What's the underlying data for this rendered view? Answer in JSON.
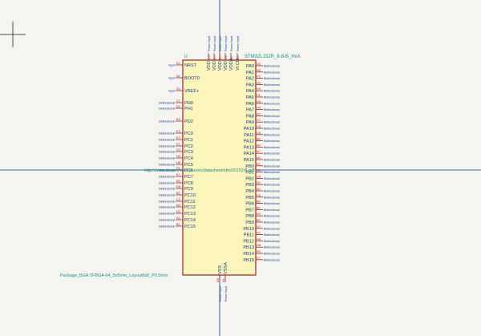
{
  "symbol": {
    "reference": "U",
    "value": "STM32L152R_6-8-B_HxA",
    "footprint": "Package_BGA:TFBGA-64_5x5mm_Layout8x8_P0.5mm",
    "datasheet": "http://www.st.com/resource/en/datasheet/stm32l152r6.pdf",
    "colors": {
      "pin": "#a02020",
      "body_fill": "#fcf6bd",
      "text": "#0e3a8c",
      "field": "#1a8a8a"
    }
  },
  "pins": {
    "top": [
      {
        "name": "VDD",
        "number": "D4",
        "type": "Power Input"
      },
      {
        "name": "VDD",
        "number": "E5",
        "type": "Power Input"
      },
      {
        "name": "VDD",
        "number": "F5",
        "type": "Power Input"
      },
      {
        "name": "VDD",
        "number": "G5",
        "type": "Power Input"
      },
      {
        "name": "VDDA",
        "number": "H7",
        "type": "Power Input"
      },
      {
        "name": "VLCD",
        "number": "B5",
        "type": "Power Input"
      }
    ],
    "left": [
      {
        "name": "NRST",
        "number": "E1",
        "type": "Input"
      },
      {
        "name": "BOOT0",
        "number": "A4",
        "type": "Input"
      },
      {
        "name": "VREF+",
        "number": "G1",
        "type": "Input"
      },
      {
        "name": "PH0",
        "number": "C1",
        "type": "Bidirectional"
      },
      {
        "name": "PH1",
        "number": "D1",
        "type": "Bidirectional"
      },
      {
        "name": "PD2",
        "number": "B3",
        "type": "Bidirectional"
      },
      {
        "name": "PC0",
        "number": "E3",
        "type": "Bidirectional"
      },
      {
        "name": "PC1",
        "number": "E2",
        "type": "Bidirectional"
      },
      {
        "name": "PC2",
        "number": "F2",
        "type": "Bidirectional"
      },
      {
        "name": "PC3",
        "number": "G1",
        "type": "Bidirectional"
      },
      {
        "name": "PC4",
        "number": "H4",
        "type": "Bidirectional"
      },
      {
        "name": "PC5",
        "number": "H5",
        "type": "Bidirectional"
      },
      {
        "name": "PC6",
        "number": "F6",
        "type": "Bidirectional"
      },
      {
        "name": "PC7",
        "number": "E7",
        "type": "Bidirectional"
      },
      {
        "name": "PC8",
        "number": "E8",
        "type": "Bidirectional"
      },
      {
        "name": "PC9",
        "number": "D8",
        "type": "Bidirectional"
      },
      {
        "name": "PC10",
        "number": "B2",
        "type": "Bidirectional"
      },
      {
        "name": "PC11",
        "number": "C2",
        "type": "Bidirectional"
      },
      {
        "name": "PC12",
        "number": "A3",
        "type": "Bidirectional"
      },
      {
        "name": "PC13",
        "number": "D2",
        "type": "Bidirectional"
      },
      {
        "name": "PC14",
        "number": "A1",
        "type": "Bidirectional"
      },
      {
        "name": "PC15",
        "number": "B1",
        "type": "Bidirectional"
      }
    ],
    "right": [
      {
        "name": "PA0",
        "number": "G3",
        "type": "Bidirectional"
      },
      {
        "name": "PA1",
        "number": "H2",
        "type": "Bidirectional"
      },
      {
        "name": "PA2",
        "number": "F3",
        "type": "Bidirectional"
      },
      {
        "name": "PA3",
        "number": "G3",
        "type": "Bidirectional"
      },
      {
        "name": "PA4",
        "number": "H3",
        "type": "Bidirectional"
      },
      {
        "name": "PA5",
        "number": "F4",
        "type": "Bidirectional"
      },
      {
        "name": "PA6",
        "number": "G4",
        "type": "Bidirectional"
      },
      {
        "name": "PA7",
        "number": "H4",
        "type": "Bidirectional"
      },
      {
        "name": "PA8",
        "number": "D7",
        "type": "Bidirectional"
      },
      {
        "name": "PA9",
        "number": "C7",
        "type": "Bidirectional"
      },
      {
        "name": "PA10",
        "number": "C6",
        "type": "Bidirectional"
      },
      {
        "name": "PA11",
        "number": "C8",
        "type": "Bidirectional"
      },
      {
        "name": "PA12",
        "number": "B8",
        "type": "Bidirectional"
      },
      {
        "name": "PA13",
        "number": "A8",
        "type": "Bidirectional"
      },
      {
        "name": "PA14",
        "number": "A7",
        "type": "Bidirectional"
      },
      {
        "name": "PA15",
        "number": "A6",
        "type": "Bidirectional"
      },
      {
        "name": "PB0",
        "number": "F5",
        "type": "Bidirectional"
      },
      {
        "name": "PB1",
        "number": "G5",
        "type": "Bidirectional"
      },
      {
        "name": "PB2",
        "number": "G6",
        "type": "Bidirectional"
      },
      {
        "name": "PB3",
        "number": "A5",
        "type": "Bidirectional"
      },
      {
        "name": "PB4",
        "number": "A4",
        "type": "Bidirectional"
      },
      {
        "name": "PB5",
        "number": "C5",
        "type": "Bidirectional"
      },
      {
        "name": "PB6",
        "number": "B5",
        "type": "Bidirectional"
      },
      {
        "name": "PB7",
        "number": "B4",
        "type": "Bidirectional"
      },
      {
        "name": "PB8",
        "number": "A3",
        "type": "Bidirectional"
      },
      {
        "name": "PB9",
        "number": "B3",
        "type": "Bidirectional"
      },
      {
        "name": "PB10",
        "number": "G7",
        "type": "Bidirectional"
      },
      {
        "name": "PB11",
        "number": "H7",
        "type": "Bidirectional"
      },
      {
        "name": "PB12",
        "number": "H8",
        "type": "Bidirectional"
      },
      {
        "name": "PB13",
        "number": "G8",
        "type": "Bidirectional"
      },
      {
        "name": "PB14",
        "number": "F8",
        "type": "Bidirectional"
      },
      {
        "name": "PB15",
        "number": "F7",
        "type": "Bidirectional"
      }
    ],
    "bottom": [
      {
        "name": "VSS",
        "number": "D5",
        "type": "Power Input"
      },
      {
        "name": "VSSA",
        "number": "H1",
        "type": "Power Input"
      }
    ]
  }
}
